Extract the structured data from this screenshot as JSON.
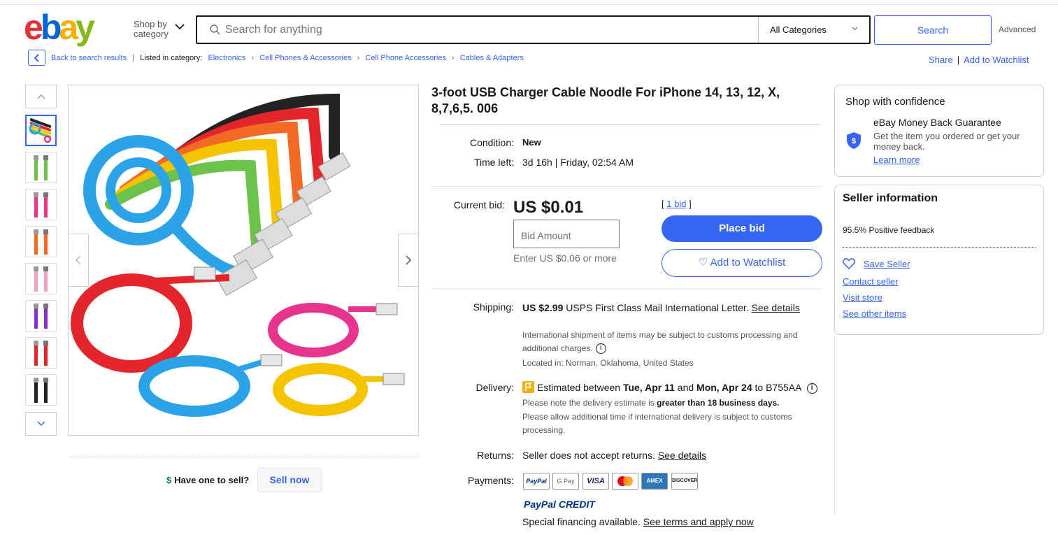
{
  "header": {
    "logo_letters": [
      "e",
      "b",
      "a",
      "y"
    ],
    "shop_by_category": "Shop by category",
    "search_placeholder": "Search for anything",
    "category_select": "All Categories",
    "search_button": "Search",
    "advanced_link": "Advanced"
  },
  "breadcrumb": {
    "back_link": "Back to search results",
    "separator": "|",
    "listed_in": "Listed in category:",
    "items": [
      "Electronics",
      "Cell Phones & Accessories",
      "Cell Phone Accessories",
      "Cables & Adapters"
    ],
    "share": "Share",
    "add_watchlist": "Add to Watchlist"
  },
  "gallery": {
    "thumbnail_colors": [
      "multi",
      "#6cc24a",
      "#e8348c",
      "#f26b24",
      "#f3a0c4",
      "#8b2fc9",
      "#e3262b",
      "#222222"
    ],
    "selected_index": 0,
    "have_one": "Have one to sell?",
    "sell_now": "Sell now"
  },
  "listing": {
    "title": "3-foot USB Charger Cable Noodle For iPhone 14, 13, 12, X, 8,7,6,5. 006",
    "condition_label": "Condition:",
    "condition_value": "New",
    "time_left_label": "Time left:",
    "time_left_value": "3d 16h | Friday, 02:54 AM",
    "current_bid_label": "Current bid:",
    "current_bid_value": "US $0.01",
    "bid_count_prefix": "[",
    "bid_count": "1 bid",
    "bid_count_suffix": "]",
    "bid_input_placeholder": "Bid Amount",
    "bid_hint": "Enter US $0.06 or more",
    "place_bid": "Place bid",
    "add_watchlist": "Add to Watchlist",
    "shipping_label": "Shipping:",
    "shipping_price": "US $2.99",
    "shipping_method": "USPS First Class Mail International Letter.",
    "shipping_see_details": "See details",
    "shipping_note": "International shipment of items may be subject to customs processing and additional charges.",
    "location": "Located in: Norman, Oklahoma, United States",
    "delivery_label": "Delivery:",
    "delivery_pre": "Estimated between",
    "delivery_date1": "Tue, Apr 11",
    "delivery_and": "and",
    "delivery_date2": "Mon, Apr 24",
    "delivery_to": "to B755AA",
    "delivery_note_pre": "Please note the delivery estimate is",
    "delivery_note_bold": "greater than 18 business days.",
    "delivery_note2": "Please allow additional time if international delivery is subject to customs processing.",
    "returns_label": "Returns:",
    "returns_value": "Seller does not accept returns.",
    "returns_see_details": "See details",
    "payments_label": "Payments:",
    "payment_methods": [
      "PayPal",
      "G Pay",
      "VISA",
      "mastercard",
      "AMEX",
      "DISCOVER"
    ],
    "paypal_credit_1": "PayPal",
    "paypal_credit_2": "CREDIT",
    "financing_text": "Special financing available.",
    "financing_link": "See terms and apply now"
  },
  "confidence": {
    "heading": "Shop with confidence",
    "guarantee_title": "eBay Money Back Guarantee",
    "guarantee_text": "Get the item you ordered or get your money back.",
    "learn_more": "Learn more"
  },
  "seller": {
    "heading": "Seller information",
    "feedback": "95.5% Positive feedback",
    "save_seller": "Save Seller",
    "contact": "Contact seller",
    "visit_store": "Visit store",
    "other_items": "See other items"
  },
  "colors": {
    "ebay_blue": "#3665f3",
    "place_bid_bg": "#3665f3",
    "logo_e": "#e53238",
    "logo_b": "#0064d2",
    "logo_a": "#f5af02",
    "logo_y": "#86b817"
  }
}
